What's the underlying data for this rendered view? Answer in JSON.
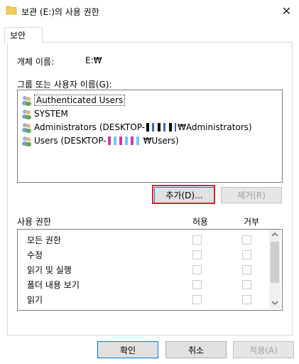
{
  "window": {
    "title": "보관 (E:)의 사용 권한",
    "close_glyph": "✕"
  },
  "tab": {
    "label": "보안"
  },
  "object": {
    "label": "개체 이름:",
    "value": "E:₩"
  },
  "group": {
    "label": "그룹 또는 사용자 이름(G):",
    "items": [
      "Authenticated Users",
      "SYSTEM",
      "Administrators (DESKTOP-",
      "Users (DESKTOP-"
    ],
    "item_suffixes": [
      "",
      "",
      "₩Administrators)",
      "₩Users)"
    ]
  },
  "buttons": {
    "add": "추가(D)...",
    "remove": "제거(R)",
    "ok": "확인",
    "cancel": "취소",
    "apply": "적용(A)"
  },
  "permissions": {
    "header": "사용 권한",
    "allow": "허용",
    "deny": "거부",
    "rows": [
      "모든 권한",
      "수정",
      "읽기 및 실행",
      "폴더 내용 보기",
      "읽기"
    ]
  },
  "colors": {
    "highlight": "#d9232d",
    "accent": "#0078d7"
  }
}
